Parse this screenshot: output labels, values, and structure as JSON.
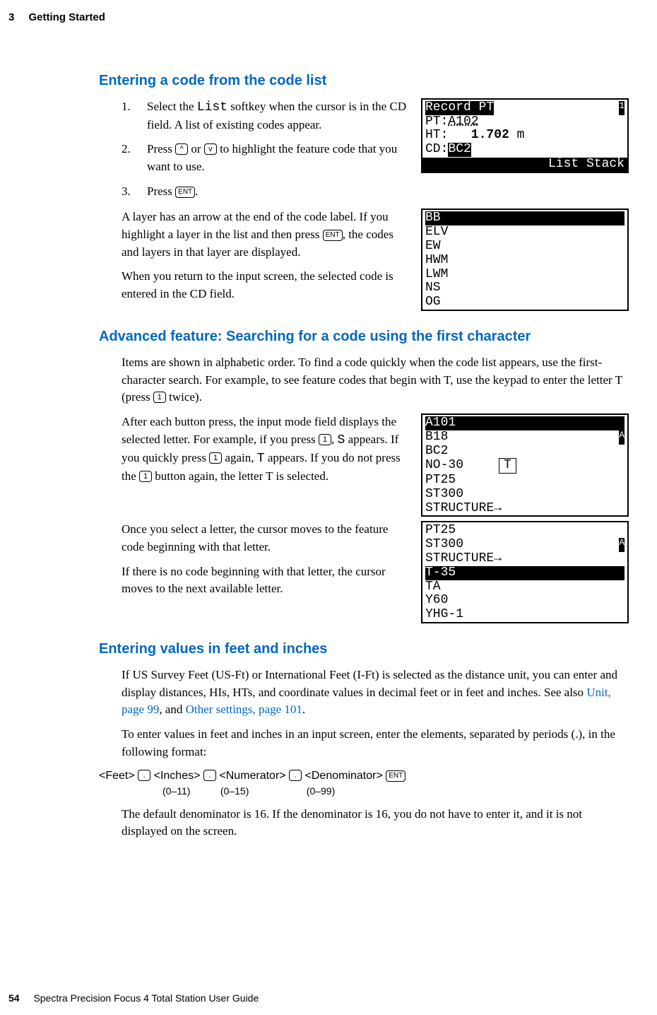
{
  "header": {
    "chapter_num": "3",
    "chapter_title": "Getting Started"
  },
  "footer": {
    "page_num": "54",
    "book_title": "Spectra Precision Focus 4 Total Station User Guide"
  },
  "keys": {
    "up": "^",
    "down": "v",
    "ent": "ENT",
    "one": "1",
    "dot": "."
  },
  "sec1": {
    "title": "Entering a code from the code list",
    "step1a": "Select the ",
    "step1_soft": "List",
    "step1b": " softkey when the cursor is in the CD field. A list of existing codes appear.",
    "step2a": "Press ",
    "step2b": " or ",
    "step2c": " to highlight the feature code that you want to use.",
    "step3a": "Press ",
    "step3b": ".",
    "p1a": "A layer has an arrow at the end of the code label. If you highlight a layer in the list and then press ",
    "p1b": ", the codes and layers in that layer are displayed.",
    "p2": "When you return to the input screen, the selected code is entered in the CD field."
  },
  "fig1": {
    "title": "Record PT",
    "page_ind": "1",
    "pt_lbl": "PT:",
    "pt_val": "A102",
    "ht_lbl": "HT:",
    "ht_val": "   1.702",
    "ht_unit": " m",
    "cd_lbl": "CD:",
    "cd_val": "BC2",
    "softkeys": "List Stack"
  },
  "fig2": {
    "l1": "BB",
    "l2": "ELV",
    "l3": "EW",
    "l4": "HWM",
    "l5": "LWM",
    "l6": "NS",
    "l7": "OG"
  },
  "sec2": {
    "title": "Advanced feature: Searching for a code using the first character",
    "p1a": "Items are shown in alphabetic order. To find a code quickly when the code list appears, use the first-character search. For example, to see feature codes that begin with T, use the keypad to enter the letter T (press ",
    "p1b": " twice).",
    "p2a": "After each button press, the input mode field displays the selected letter. For example, if you press ",
    "p2b": ", ",
    "p2_s": "S",
    "p2c": " appears. If you quickly press ",
    "p2d": " again, ",
    "p2_t": "T",
    "p2e": " appears. If you do not press the ",
    "p2f": " button again, the letter T is selected.",
    "p3": "Once you select a letter, the cursor moves to the feature code beginning with that letter.",
    "p4": "If there is no code beginning with that letter, the cursor moves to the next available letter."
  },
  "fig3": {
    "l1": "A101",
    "l2": "B18",
    "l3": "BC2",
    "l4": "NO-30",
    "box": "T",
    "l5": "PT25",
    "l6": "ST300",
    "l7": "STRUCTURE→",
    "ind": "A"
  },
  "fig4": {
    "l1": "PT25",
    "l2": "ST300",
    "l3": "STRUCTURE→",
    "l4": "T-35",
    "l5": "TA",
    "l6": "Y60",
    "l7": "YHG-1",
    "ind": "A"
  },
  "sec3": {
    "title": "Entering values in feet and inches",
    "p1a": "If US Survey Feet (US-Ft) or International Feet (I-Ft) is selected as the distance unit, you can enter and display distances, HIs, HTs, and coordinate values in decimal feet or in feet and inches. See also ",
    "link1": "Unit, page 99",
    "p1b": ", and ",
    "link2": "Other settings, page 101",
    "p1c": ".",
    "p2": "To enter values in feet and inches in an input screen, enter the elements, separated by periods (.), in the following format:",
    "fmt_feet": "<Feet>",
    "fmt_in": "<Inches>",
    "fmt_num": "<Numerator>",
    "fmt_den": "<Denominator>",
    "sub_in": "(0–11)",
    "sub_num": "(0–15)",
    "sub_den": "(0–99)",
    "p3": "The default denominator is 16. If the denominator is 16, you do not have to enter it, and it is not displayed on the screen."
  }
}
